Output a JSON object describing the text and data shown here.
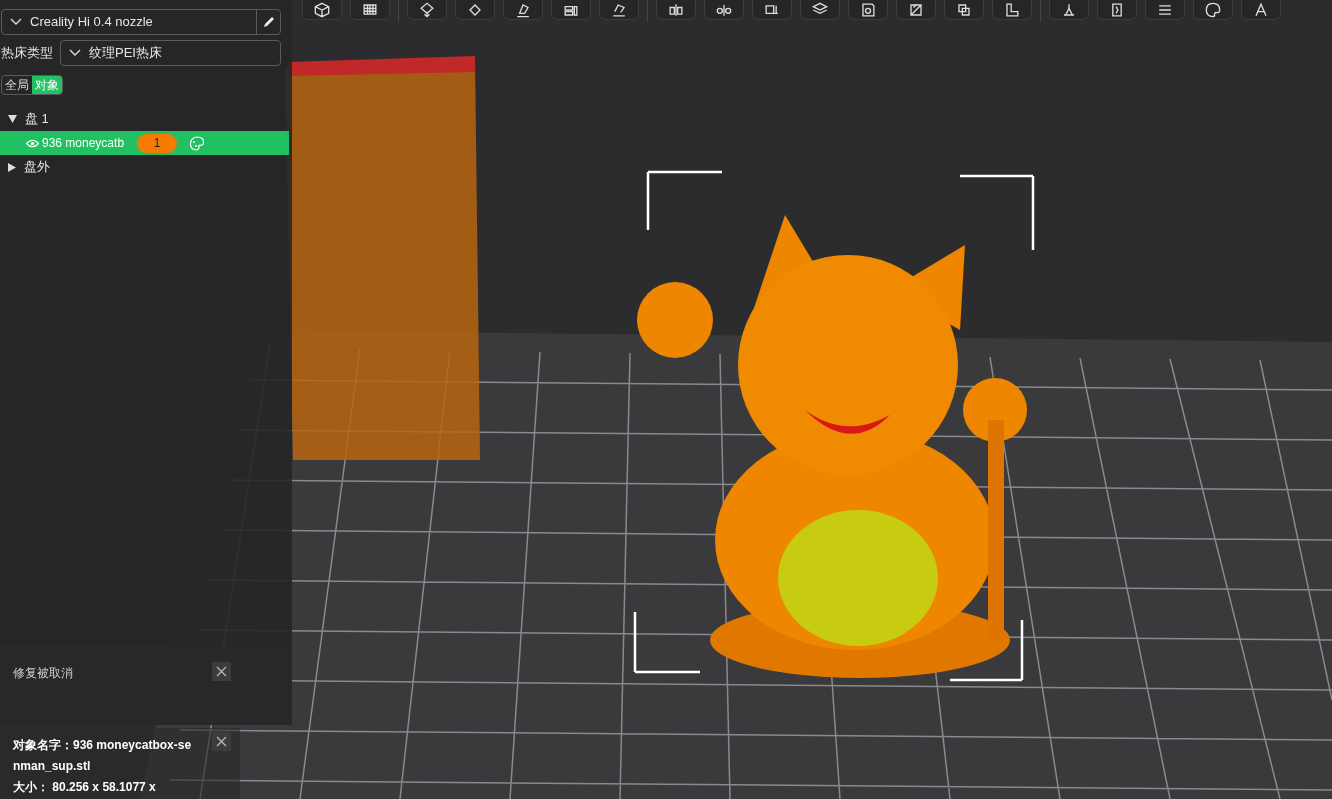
{
  "printer": {
    "value": "Creality Hi 0.4 nozzle"
  },
  "bed": {
    "label": "热床类型",
    "value": "纹理PEI热床"
  },
  "tabs": [
    {
      "label": "全局",
      "selected": false
    },
    {
      "label": "对象",
      "selected": true
    }
  ],
  "tree": [
    {
      "label": "盘 1",
      "expanded": true,
      "children": [
        {
          "label": "936 moneycatb",
          "badge": "1",
          "selected": true
        }
      ]
    },
    {
      "label": "盘外",
      "expanded": false
    }
  ],
  "notifications": [
    {
      "lines": [
        "修复被取消"
      ]
    },
    {
      "lines": [
        "对象名字：936 moneycatbox-se",
        "nman_sup.stl",
        "大小： 80.256 x 58.1077 x"
      ]
    }
  ]
}
